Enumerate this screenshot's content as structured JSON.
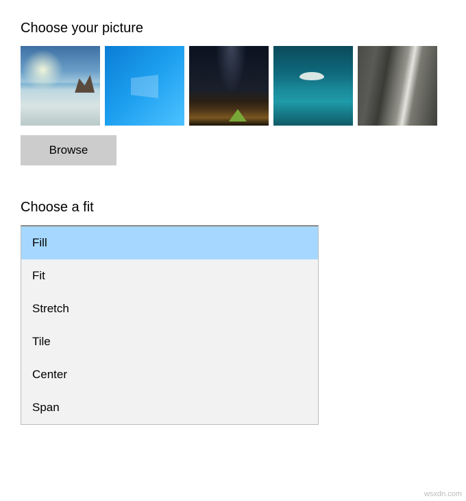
{
  "picture_section": {
    "label": "Choose your picture",
    "thumbnails": [
      {
        "name": "beach-landscape"
      },
      {
        "name": "blue-windows"
      },
      {
        "name": "night-sky-tent"
      },
      {
        "name": "underwater-turtle"
      },
      {
        "name": "rock-waterfall"
      }
    ],
    "browse_button": "Browse"
  },
  "fit_section": {
    "label": "Choose a fit",
    "selected": "Fill",
    "options": [
      "Fill",
      "Fit",
      "Stretch",
      "Tile",
      "Center",
      "Span"
    ]
  },
  "watermark": "wsxdn.com"
}
